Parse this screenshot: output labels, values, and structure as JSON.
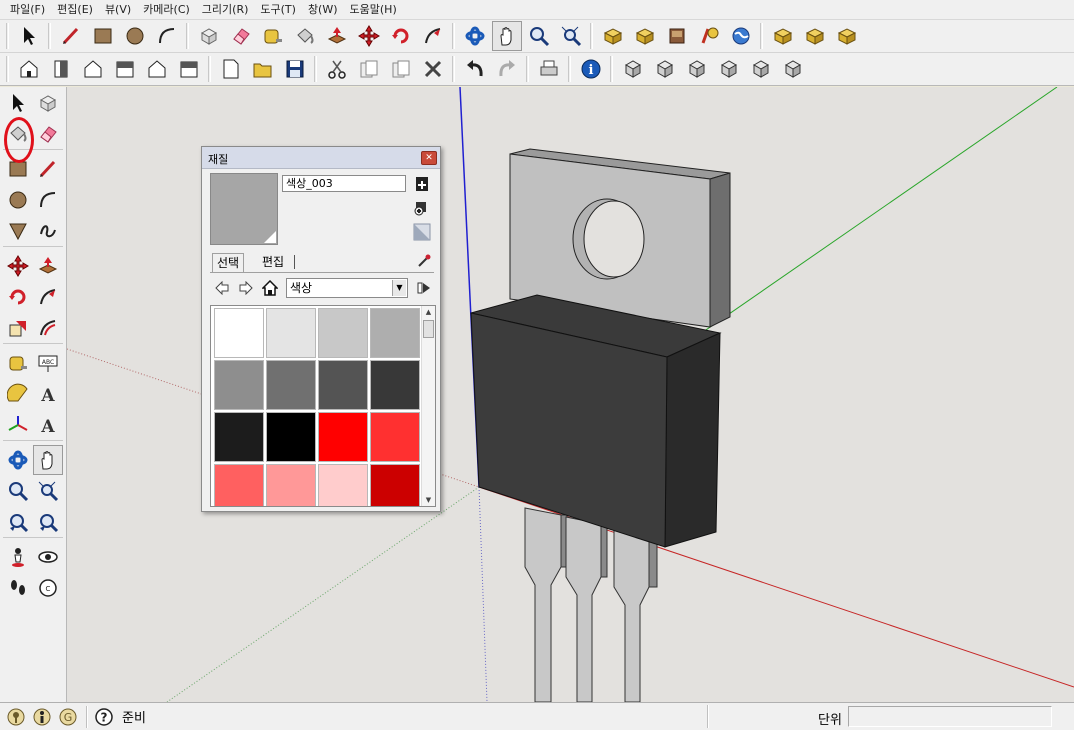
{
  "menu": [
    {
      "label": "파일(F)"
    },
    {
      "label": "편집(E)"
    },
    {
      "label": "뷰(V)"
    },
    {
      "label": "카메라(C)"
    },
    {
      "label": "그리기(R)"
    },
    {
      "label": "도구(T)"
    },
    {
      "label": "창(W)"
    },
    {
      "label": "도움말(H)"
    }
  ],
  "toolbar1_icons": [
    "select-icon",
    "pencil-icon",
    "rectangle-icon",
    "circle-icon",
    "arc-icon",
    "make-component-icon",
    "eraser-icon",
    "tape-measure-icon",
    "paint-bucket-icon",
    "push-pull-icon",
    "move-icon",
    "rotate-icon",
    "follow-me-icon",
    "orbit-icon",
    "pan-icon",
    "zoom-icon",
    "zoom-extents-icon",
    "get-models-icon",
    "share-model-icon",
    "get-photo-texture-icon",
    "place-model-icon",
    "google-earth-icon",
    "components-icon",
    "upload-icon",
    "share-component-icon"
  ],
  "toolbar2_icons": [
    "iso-view-icon",
    "top-view-icon",
    "front-view-icon",
    "right-view-icon",
    "back-view-icon",
    "left-view-icon",
    "new-icon",
    "open-icon",
    "save-icon",
    "cut-icon",
    "copy-icon",
    "paste-icon",
    "delete-icon",
    "undo-icon",
    "redo-icon",
    "print-icon",
    "model-info-icon",
    "xray-icon",
    "wireframe-icon",
    "hidden-line-icon",
    "shaded-icon",
    "shaded-textures-icon",
    "monochrome-icon"
  ],
  "left_toolbar_icons": [
    [
      "select-icon",
      "make-component-icon"
    ],
    [
      "paint-bucket-icon",
      "eraser-icon"
    ],
    [
      "rectangle-icon",
      "line-icon"
    ],
    [
      "circle-icon",
      "arc-icon"
    ],
    [
      "polygon-icon",
      "freehand-icon"
    ],
    [
      "move-icon",
      "push-pull-icon"
    ],
    [
      "rotate-icon",
      "follow-me-icon"
    ],
    [
      "scale-icon",
      "offset-icon"
    ],
    [
      "tape-measure-icon",
      "dimension-icon"
    ],
    [
      "protractor-icon",
      "text-icon"
    ],
    [
      "axes-icon",
      "3d-text-icon"
    ],
    [
      "orbit-icon",
      "pan-icon"
    ],
    [
      "zoom-icon",
      "zoom-window-icon"
    ],
    [
      "previous-view-icon",
      "next-view-icon"
    ],
    [
      "position-camera-icon",
      "look-around-icon"
    ],
    [
      "walk-icon",
      "section-plane-icon"
    ]
  ],
  "materials_dialog": {
    "title": "재질",
    "material_name": "색상_003",
    "tabs": [
      {
        "label": "선택"
      },
      {
        "label": "편집"
      }
    ],
    "collection": "색상",
    "swatch_colors": [
      "#ffffff",
      "#e4e4e4",
      "#c8c8c8",
      "#aeaeae",
      "#8e8e8e",
      "#707070",
      "#545454",
      "#383838",
      "#1c1c1c",
      "#000000",
      "#ff0000",
      "#ff3030",
      "#ff6060",
      "#ff9898",
      "#ffcccc",
      "#cc0000"
    ],
    "current_color": "#a6a6a6"
  },
  "statusbar": {
    "status_text": "준비",
    "measurements_label": "단위",
    "measurements_value": ""
  },
  "colors": {
    "viewport_bg": "#e3e1de",
    "accent_highlight": "#e0101a"
  }
}
